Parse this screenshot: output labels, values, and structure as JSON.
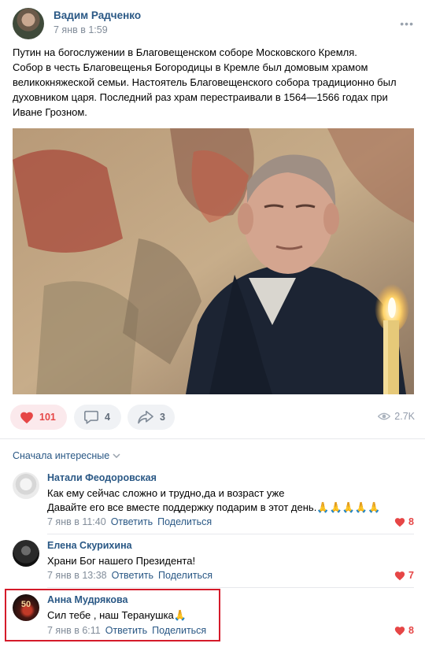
{
  "post": {
    "author": "Вадим Радченко",
    "time": "7 янв в 1:59",
    "more": "•••",
    "text_lines": [
      "Путин на богослужении в Благовещенском соборе Московского Кремля.",
      "Собор в честь Благовещенья Богородицы в Кремле был домовым храмом",
      "великокняжеской семьи. Настоятель Благовещенского собора традиционно был",
      "духовником царя. Последний раз храм перестраивали в 1564—1566 годах при",
      "Иване Грозном."
    ]
  },
  "actions": {
    "likes": "101",
    "comments": "4",
    "shares": "3",
    "views": "2.7K"
  },
  "comments_section": {
    "sort_label": "Сначала интересные"
  },
  "comments": [
    {
      "author": "Натали Феодоровская",
      "lines": [
        "Как ему сейчас сложно и трудно,да и возраст уже",
        "Давайте его все вместе поддержку подарим в этот день.🙏🙏🙏🙏🙏"
      ],
      "time": "7 янв в 11:40",
      "reply": "Ответить",
      "share": "Поделиться",
      "likes": "8"
    },
    {
      "author": "Елена Скурихина",
      "lines": [
        "Храни Бог нашего Президента!"
      ],
      "time": "7 янв в 13:38",
      "reply": "Ответить",
      "share": "Поделиться",
      "likes": "7"
    },
    {
      "author": "Анна Мудрякова",
      "lines": [
        "Сил тебе , наш Теранушка🙏"
      ],
      "time": "7 янв в 6:11",
      "reply": "Ответить",
      "share": "Поделиться",
      "likes": "8",
      "avatar_text": "50"
    }
  ],
  "colors": {
    "link": "#2a5885",
    "like_red": "#e64646",
    "highlight": "#d51b2a",
    "muted": "#818c99"
  },
  "icons": {
    "like": "heart-icon",
    "comment": "comment-bubble-icon",
    "share": "share-arrow-icon",
    "views": "eye-icon",
    "sort": "chevron-down-icon"
  }
}
